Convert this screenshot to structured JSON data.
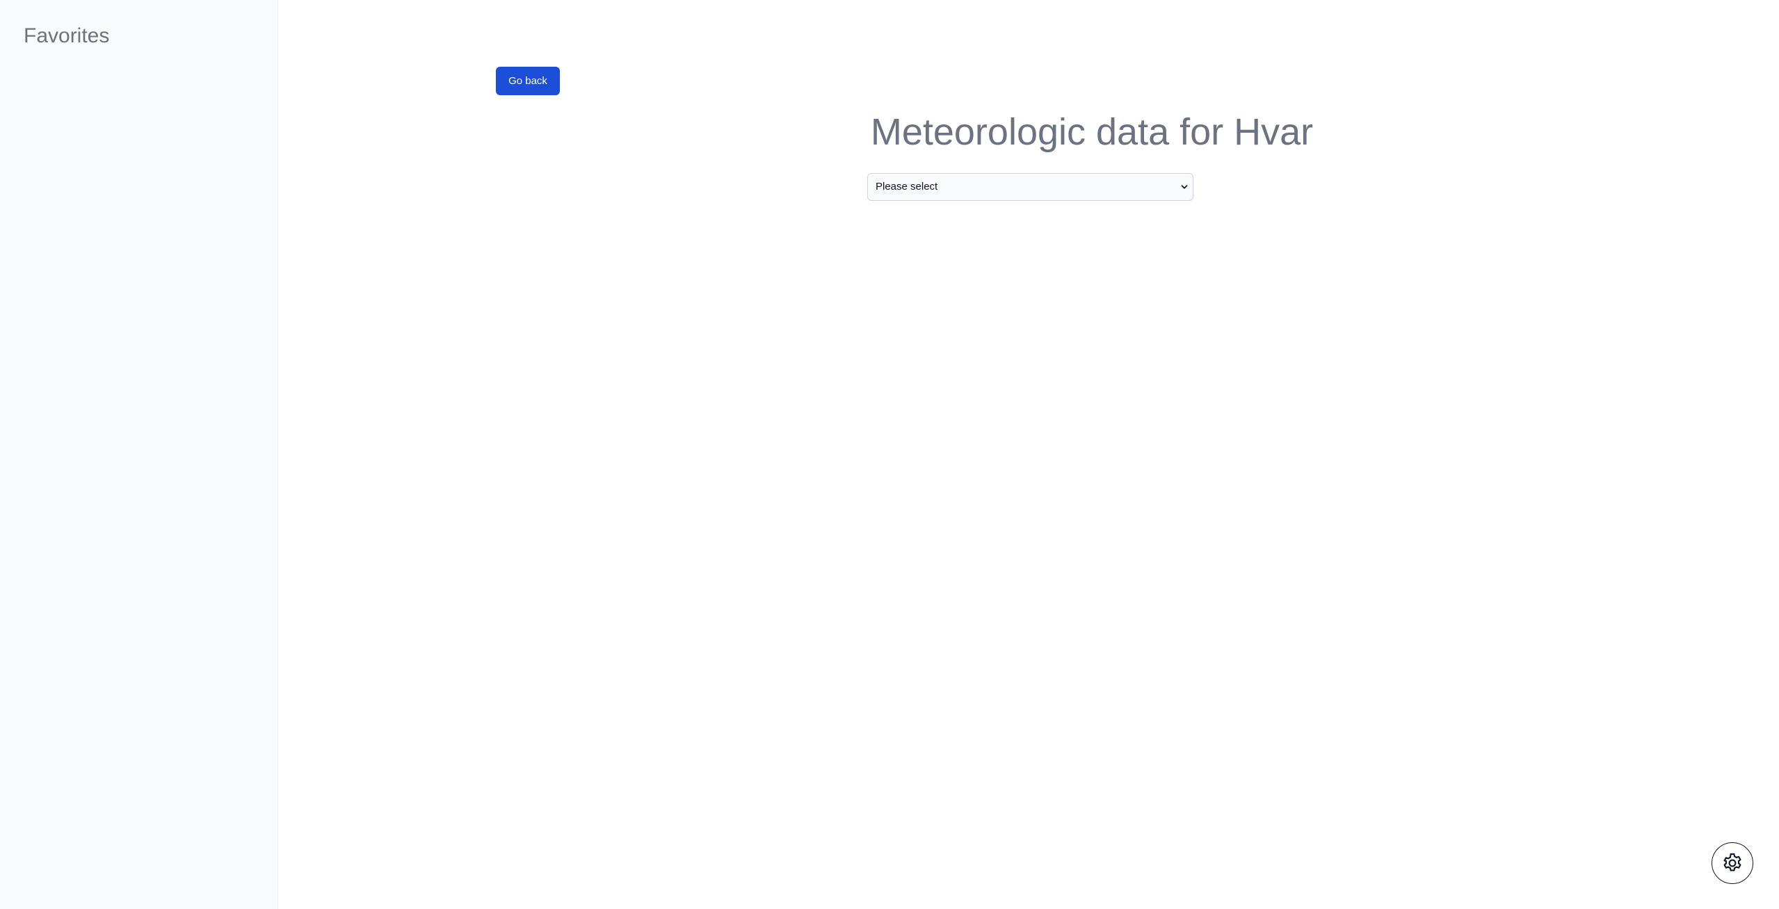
{
  "sidebar": {
    "title": "Favorites"
  },
  "main": {
    "back_button_label": "Go back",
    "title": "Meteorologic data for Hvar",
    "select": {
      "selected_value": "Please select",
      "icon": "chevron-down-icon"
    }
  },
  "settings": {
    "icon": "gear-icon"
  },
  "colors": {
    "primary": "#1d4ed8",
    "sidebar_bg": "#f9fafb",
    "muted_text": "#6b7280"
  }
}
